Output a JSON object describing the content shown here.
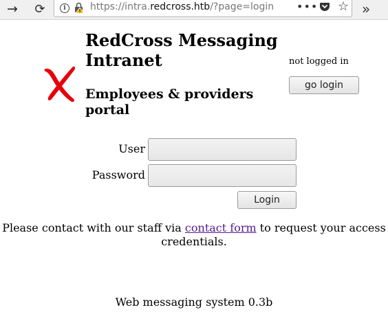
{
  "browser": {
    "url_prefix": "https://intra.",
    "url_host": "redcross.htb",
    "url_suffix": "/?page=login",
    "icons": {
      "forward": "arrow-right-icon",
      "reload": "reload-icon",
      "info": "info-icon",
      "lock": "insecure-lock-icon",
      "menu": "page-actions-icon",
      "pocket": "pocket-icon",
      "bookmark": "star-icon",
      "overflow": "overflow-chevrons-icon"
    }
  },
  "header": {
    "title": "RedCross Messaging Intranet",
    "subtitle": "Employees & providers portal",
    "logo_color": "#e8000b"
  },
  "session": {
    "status": "not logged in",
    "go_login_label": "go login"
  },
  "login_form": {
    "user_label": "User",
    "user_value": "",
    "password_label": "Password",
    "password_value": "",
    "submit_label": "Login"
  },
  "contact": {
    "text_before": "Please contact with our staff via ",
    "link_text": "contact form",
    "text_after": " to request your access credentials."
  },
  "footer": {
    "text": "Web messaging system 0.3b"
  }
}
